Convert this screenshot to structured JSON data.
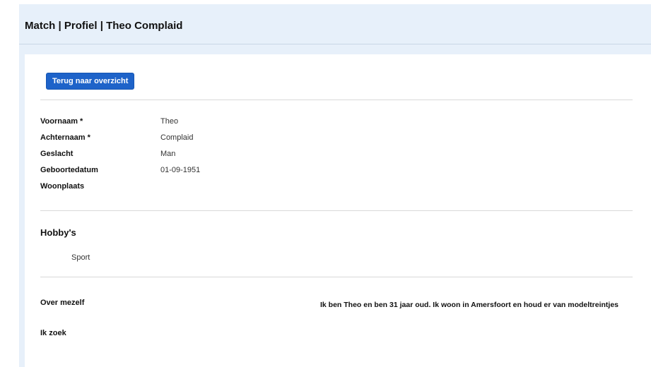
{
  "header": {
    "title": "Match | Profiel | Theo Complaid"
  },
  "actions": {
    "back_label": "Terug naar overzicht"
  },
  "profile": {
    "fields": [
      {
        "label": "Voornaam *",
        "value": "Theo"
      },
      {
        "label": "Achternaam *",
        "value": "Complaid"
      },
      {
        "label": "Geslacht",
        "value": "Man"
      },
      {
        "label": "Geboortedatum",
        "value": "01-09-1951"
      },
      {
        "label": "Woonplaats",
        "value": ""
      }
    ]
  },
  "hobbies": {
    "title": "Hobby's",
    "items": [
      "Sport"
    ]
  },
  "about": {
    "label": "Over mezelf",
    "text": "Ik ben Theo en ben 31 jaar oud. Ik woon in Amersfoort en houd er van modeltreintjes"
  },
  "search": {
    "label": "Ik zoek"
  },
  "colors": {
    "header_bg": "#e7f0fa",
    "button_bg": "#1e63c9",
    "divider": "#d9d9d9"
  }
}
